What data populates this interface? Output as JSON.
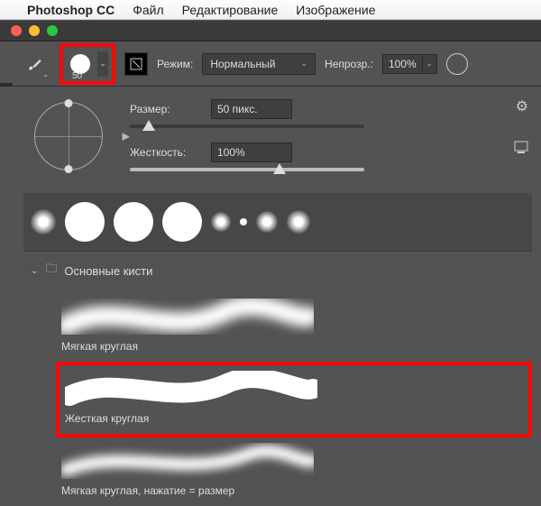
{
  "menubar": {
    "app": "Photoshop CC",
    "items": [
      "Файл",
      "Редактирование",
      "Изображение"
    ]
  },
  "toolbar": {
    "brush_size_small": "50",
    "mode_label": "Режим:",
    "mode_value": "Нормальный",
    "opacity_label": "Непрозр.:",
    "opacity_value": "100%"
  },
  "panel": {
    "size_label": "Размер:",
    "size_value": "50 пикс.",
    "hardness_label": "Жесткость:",
    "hardness_value": "100%",
    "folder_name": "Основные кисти",
    "brushes": [
      {
        "name": "Мягкая круглая"
      },
      {
        "name": "Жесткая круглая"
      },
      {
        "name": "Мягкая круглая, нажатие = размер"
      }
    ]
  }
}
